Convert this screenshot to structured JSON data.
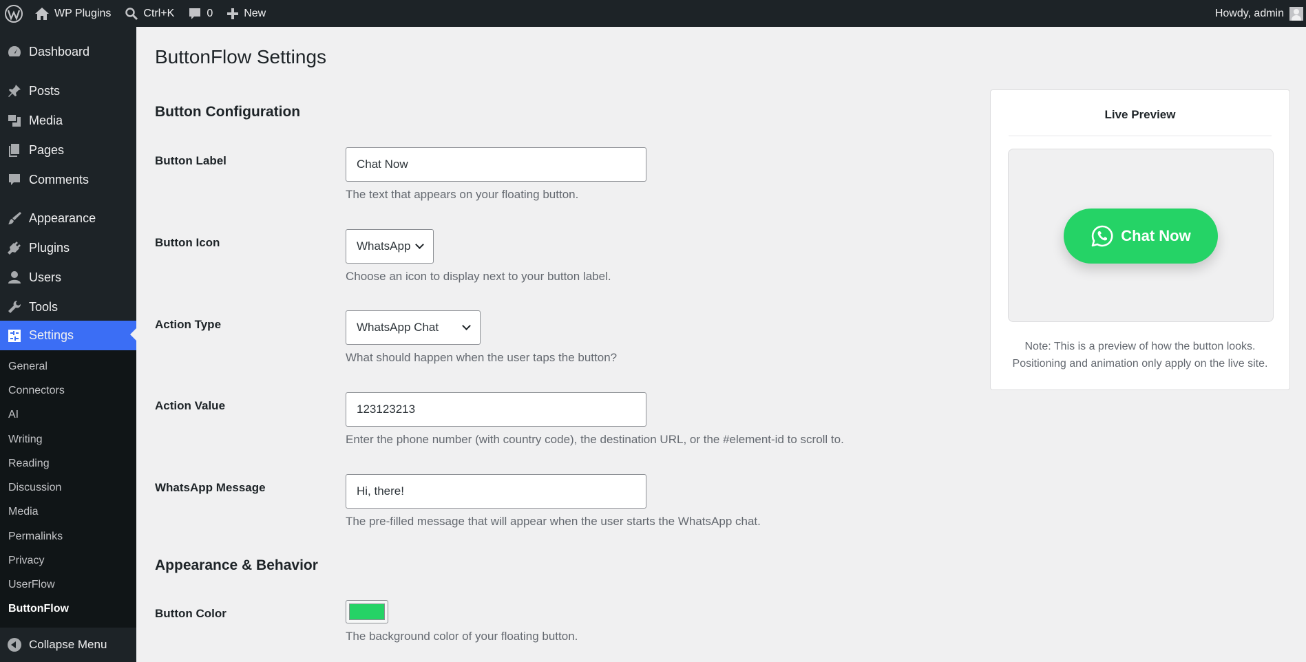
{
  "adminbar": {
    "site_name": "WP Plugins",
    "search_shortcut": "Ctrl+K",
    "comments_count": "0",
    "new_label": "New",
    "howdy": "Howdy, admin"
  },
  "sidebar": {
    "menu": [
      {
        "label": "Dashboard",
        "icon": "dashboard-icon"
      },
      {
        "label": "Posts",
        "icon": "pin-icon"
      },
      {
        "label": "Media",
        "icon": "media-icon"
      },
      {
        "label": "Pages",
        "icon": "pages-icon"
      },
      {
        "label": "Comments",
        "icon": "comment-icon"
      },
      {
        "label": "Appearance",
        "icon": "brush-icon"
      },
      {
        "label": "Plugins",
        "icon": "plug-icon"
      },
      {
        "label": "Users",
        "icon": "user-icon"
      },
      {
        "label": "Tools",
        "icon": "wrench-icon"
      },
      {
        "label": "Settings",
        "icon": "settings-icon"
      }
    ],
    "submenu": [
      "General",
      "Connectors",
      "AI",
      "Writing",
      "Reading",
      "Discussion",
      "Media",
      "Permalinks",
      "Privacy",
      "UserFlow",
      "ButtonFlow"
    ],
    "collapse_label": "Collapse Menu"
  },
  "page": {
    "title": "ButtonFlow Settings",
    "section_config": "Button Configuration",
    "section_appearance": "Appearance & Behavior",
    "fields": {
      "button_label": {
        "label": "Button Label",
        "value": "Chat Now",
        "desc": "The text that appears on your floating button."
      },
      "button_icon": {
        "label": "Button Icon",
        "value": "WhatsApp",
        "desc": "Choose an icon to display next to your button label."
      },
      "action_type": {
        "label": "Action Type",
        "value": "WhatsApp Chat",
        "desc": "What should happen when the user taps the button?"
      },
      "action_value": {
        "label": "Action Value",
        "value": "123123213",
        "desc": "Enter the phone number (with country code), the destination URL, or the #element-id to scroll to."
      },
      "whatsapp_message": {
        "label": "WhatsApp Message",
        "value": "Hi, there!",
        "desc": "The pre-filled message that will appear when the user starts the WhatsApp chat."
      },
      "button_color": {
        "label": "Button Color",
        "value": "#25d366",
        "desc": "The background color of your floating button."
      }
    }
  },
  "preview": {
    "title": "Live Preview",
    "button_label": "Chat Now",
    "note_line1": "Note: This is a preview of how the button looks.",
    "note_line2": "Positioning and animation only apply on the live site."
  },
  "colors": {
    "adminbar_bg": "#1d2327",
    "accent": "#3b6ef5",
    "whatsapp_green": "#25d366"
  }
}
